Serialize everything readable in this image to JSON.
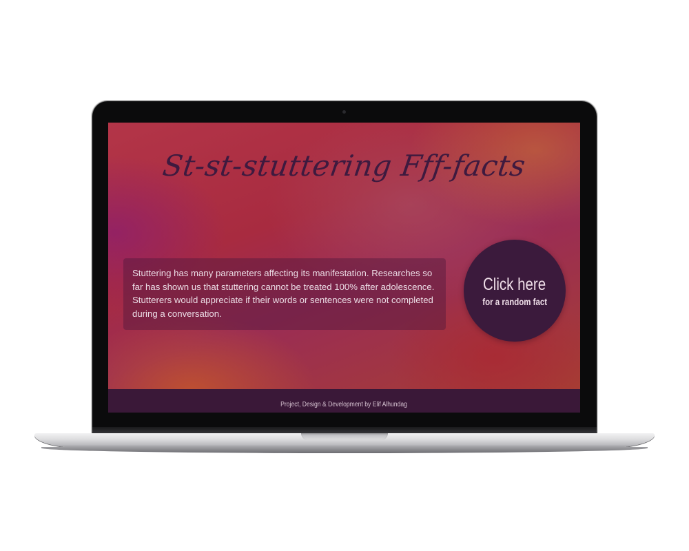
{
  "page": {
    "title": "St-st-stuttering Fff-facts"
  },
  "fact": {
    "text": "Stuttering has many parameters affecting its manifestation. Researches so far has shown us that stuttering cannot be treated 100% after adolescence. Stutterers would appreciate if their words or sentences were not completed during a conversation."
  },
  "random_button": {
    "title": "Click here",
    "subtitle": "for a random fact"
  },
  "footer": {
    "text": "Project, Design & Development by Elif Alhundag"
  },
  "colors": {
    "title": "#3e1a3f",
    "button_bg": "#3b1a3c",
    "footer_bg": "#3a1838",
    "card_text": "#ecdde6"
  }
}
